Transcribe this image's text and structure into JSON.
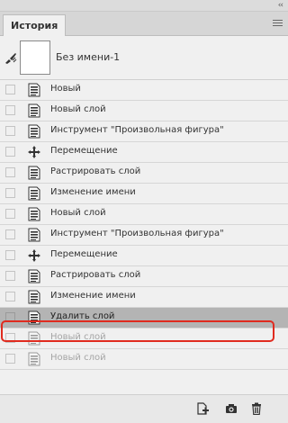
{
  "panel": {
    "tab_label": "История",
    "collapse_glyph": "‹‹",
    "snapshot_label": "Без имени-1"
  },
  "history": [
    {
      "label": "Новый",
      "icon": "document-icon",
      "state": "past"
    },
    {
      "label": "Новый слой",
      "icon": "document-icon",
      "state": "past"
    },
    {
      "label": "Инструмент \"Произвольная фигура\"",
      "icon": "document-icon",
      "state": "past"
    },
    {
      "label": "Перемещение",
      "icon": "move-icon",
      "state": "past"
    },
    {
      "label": "Растрировать слой",
      "icon": "document-icon",
      "state": "past"
    },
    {
      "label": "Изменение имени",
      "icon": "document-icon",
      "state": "past"
    },
    {
      "label": "Новый слой",
      "icon": "document-icon",
      "state": "past"
    },
    {
      "label": "Инструмент \"Произвольная фигура\"",
      "icon": "document-icon",
      "state": "past"
    },
    {
      "label": "Перемещение",
      "icon": "move-icon",
      "state": "past"
    },
    {
      "label": "Растрировать слой",
      "icon": "document-icon",
      "state": "past"
    },
    {
      "label": "Изменение имени",
      "icon": "document-icon",
      "state": "past"
    },
    {
      "label": "Удалить слой",
      "icon": "document-icon",
      "state": "current"
    },
    {
      "label": "Новый слой",
      "icon": "document-icon",
      "state": "future"
    },
    {
      "label": "Новый слой",
      "icon": "document-icon",
      "state": "future"
    }
  ],
  "highlight_color": "#e02b1f",
  "footer_icons": [
    "new-document-from-state-icon",
    "camera-icon",
    "trash-icon"
  ]
}
